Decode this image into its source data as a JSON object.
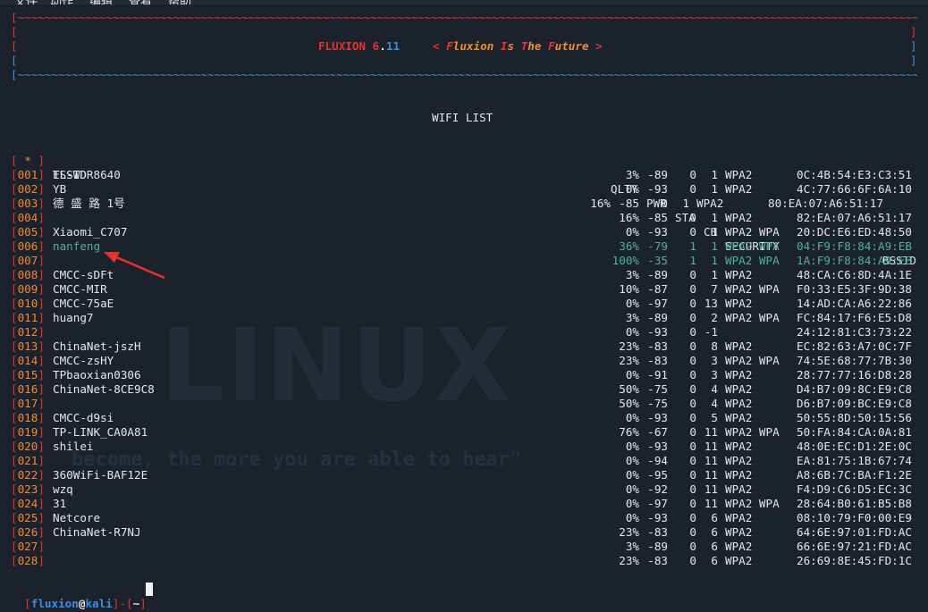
{
  "menu": [
    "文件",
    "动作",
    "编辑",
    "查看",
    "帮助"
  ],
  "banner": {
    "border_top": "[~~~~~~~~~~~~~~~~~~~~~~~~~~~~~~~~~~~~~~~~~~~~~~~~~~~~~~~~~~~~~~~~~~~~~~~~~~~~~~~~~~~~~~~~~~~~~~~~~~~~~~~~~~~~~~~~~~~~~~~~~~~~~~~~~~~~~~~~~~~~~~~~~~~~~~~~~~~~~~]",
    "name": "FLUXION",
    "version_major": "6",
    "version_dot": ".",
    "version_minor": "11",
    "tag_open": "<",
    "tag_words": [
      {
        "cap": "F",
        "rest": "luxion"
      },
      {
        "cap": "I",
        "rest": "s"
      },
      {
        "cap": "T",
        "rest": "he"
      },
      {
        "cap": "F",
        "rest": "uture"
      }
    ],
    "tag_close": ">",
    "border_bottom": "[~~~~~~~~~~~~~~~~~~~~~~~~~~~~~~~~~~~~~~~~~~~~~~~~~~~~~~~~~~~~~~~~~~~~~~~~~~~~~~~~~~~~~~~~~~~~~~~~~~~~~~~~~~~~~~~~~~~~~~~~~~~~~~~~~~~~~~~~~~~~~~~~~~~~~~~~~~~~~~]"
  },
  "title": "WIFI LIST",
  "header": {
    "marker": "[ * ]",
    "essid": "ESSID",
    "qlty": "QLTY",
    "pwr": "PWR",
    "sta": "STA",
    "ch": "CH",
    "security": "SECURITY",
    "bssid": "BSSID"
  },
  "rows": [
    {
      "id": "001",
      "essid": "TL-WDR8640",
      "qlty": "3%",
      "pwr": "-89",
      "sta": "0",
      "ch": "1",
      "sec": "WPA2",
      "bssid": "0C:4B:54:E3:C3:51",
      "hl": false
    },
    {
      "id": "002",
      "essid": "YB",
      "qlty": "0%",
      "pwr": "-93",
      "sta": "0",
      "ch": "1",
      "sec": "WPA2",
      "bssid": "4C:77:66:6F:6A:10",
      "hl": false
    },
    {
      "id": "003",
      "essid": "德 盛 路 1号",
      "qlty": "16%",
      "pwr": "-85",
      "sta": "0",
      "ch": "1",
      "sec": "WPA2",
      "bssid": "80:EA:07:A6:51:17",
      "hl": false,
      "shift": true
    },
    {
      "id": "004",
      "essid": "",
      "qlty": "16%",
      "pwr": "-85",
      "sta": "0",
      "ch": "1",
      "sec": "WPA2",
      "bssid": "82:EA:07:A6:51:17",
      "hl": false
    },
    {
      "id": "005",
      "essid": "Xiaomi_C707",
      "qlty": "0%",
      "pwr": "-93",
      "sta": "0",
      "ch": "1",
      "sec": "WPA2 WPA",
      "bssid": "20:DC:E6:ED:48:50",
      "hl": false
    },
    {
      "id": "006",
      "essid": "nanfeng",
      "qlty": "36%",
      "pwr": "-79",
      "sta": "1",
      "ch": "1",
      "sec": "WPA2 WPA",
      "bssid": "04:F9:F8:84:A9:EB",
      "hl": true
    },
    {
      "id": "007",
      "essid": "",
      "qlty": "100%",
      "pwr": "-35",
      "sta": "1",
      "ch": "1",
      "sec": "WPA2 WPA",
      "bssid": "1A:F9:F8:84:A9:EB",
      "hl": true
    },
    {
      "id": "008",
      "essid": "CMCC-sDFt",
      "qlty": "3%",
      "pwr": "-89",
      "sta": "0",
      "ch": "1",
      "sec": "WPA2",
      "bssid": "48:CA:C6:8D:4A:1E",
      "hl": false
    },
    {
      "id": "009",
      "essid": "CMCC-MIR",
      "qlty": "10%",
      "pwr": "-87",
      "sta": "0",
      "ch": "7",
      "sec": "WPA2 WPA",
      "bssid": "F0:33:E5:3F:9D:38",
      "hl": false
    },
    {
      "id": "010",
      "essid": "CMCC-75aE",
      "qlty": "0%",
      "pwr": "-97",
      "sta": "0",
      "ch": "13",
      "sec": "WPA2",
      "bssid": "14:AD:CA:A6:22:86",
      "hl": false
    },
    {
      "id": "011",
      "essid": "huang7",
      "qlty": "3%",
      "pwr": "-89",
      "sta": "0",
      "ch": "2",
      "sec": "WPA2 WPA",
      "bssid": "FC:84:17:F6:E5:D8",
      "hl": false
    },
    {
      "id": "012",
      "essid": "",
      "qlty": "0%",
      "pwr": "-93",
      "sta": "0",
      "ch": "-1",
      "sec": "",
      "bssid": "24:12:81:C3:73:22",
      "hl": false
    },
    {
      "id": "013",
      "essid": "ChinaNet-jszH",
      "qlty": "23%",
      "pwr": "-83",
      "sta": "0",
      "ch": "8",
      "sec": "WPA2",
      "bssid": "EC:82:63:A7:0C:7F",
      "hl": false
    },
    {
      "id": "014",
      "essid": "CMCC-zsHY",
      "qlty": "23%",
      "pwr": "-83",
      "sta": "0",
      "ch": "3",
      "sec": "WPA2 WPA",
      "bssid": "74:5E:68:77:7B:30",
      "hl": false
    },
    {
      "id": "015",
      "essid": "TPbaoxian0306",
      "qlty": "0%",
      "pwr": "-91",
      "sta": "0",
      "ch": "3",
      "sec": "WPA2",
      "bssid": "28:77:77:16:D8:28",
      "hl": false
    },
    {
      "id": "016",
      "essid": "ChinaNet-8CE9C8",
      "qlty": "50%",
      "pwr": "-75",
      "sta": "0",
      "ch": "4",
      "sec": "WPA2",
      "bssid": "D4:B7:09:8C:E9:C8",
      "hl": false
    },
    {
      "id": "017",
      "essid": "",
      "qlty": "50%",
      "pwr": "-75",
      "sta": "0",
      "ch": "4",
      "sec": "WPA2",
      "bssid": "D6:B7:09:BC:E9:C8",
      "hl": false
    },
    {
      "id": "018",
      "essid": "CMCC-d9si",
      "qlty": "0%",
      "pwr": "-93",
      "sta": "0",
      "ch": "5",
      "sec": "WPA2",
      "bssid": "50:55:8D:50:15:56",
      "hl": false
    },
    {
      "id": "019",
      "essid": "TP-LINK_CA0A81",
      "qlty": "76%",
      "pwr": "-67",
      "sta": "0",
      "ch": "11",
      "sec": "WPA2 WPA",
      "bssid": "50:FA:84:CA:0A:81",
      "hl": false
    },
    {
      "id": "020",
      "essid": "shilei",
      "qlty": "0%",
      "pwr": "-93",
      "sta": "0",
      "ch": "11",
      "sec": "WPA2",
      "bssid": "48:0E:EC:D1:2E:0C",
      "hl": false
    },
    {
      "id": "021",
      "essid": "",
      "qlty": "0%",
      "pwr": "-94",
      "sta": "0",
      "ch": "11",
      "sec": "WPA2",
      "bssid": "EA:81:75:1B:67:74",
      "hl": false
    },
    {
      "id": "022",
      "essid": "360WiFi-BAF12E",
      "qlty": "0%",
      "pwr": "-95",
      "sta": "0",
      "ch": "11",
      "sec": "WPA2",
      "bssid": "A8:6B:7C:BA:F1:2E",
      "hl": false
    },
    {
      "id": "023",
      "essid": "wzq",
      "qlty": "0%",
      "pwr": "-92",
      "sta": "0",
      "ch": "11",
      "sec": "WPA2",
      "bssid": "F4:D9:C6:D5:EC:3C",
      "hl": false
    },
    {
      "id": "024",
      "essid": "31",
      "qlty": "0%",
      "pwr": "-97",
      "sta": "0",
      "ch": "11",
      "sec": "WPA2 WPA",
      "bssid": "28:64:B0:61:B5:B8",
      "hl": false
    },
    {
      "id": "025",
      "essid": "Netcore",
      "qlty": "0%",
      "pwr": "-93",
      "sta": "0",
      "ch": "6",
      "sec": "WPA2",
      "bssid": "08:10:79:F0:00:E9",
      "hl": false
    },
    {
      "id": "026",
      "essid": "ChinaNet-R7NJ",
      "qlty": "23%",
      "pwr": "-83",
      "sta": "0",
      "ch": "6",
      "sec": "WPA2",
      "bssid": "64:6E:97:01:FD:AC",
      "hl": false
    },
    {
      "id": "027",
      "essid": "",
      "qlty": "3%",
      "pwr": "-89",
      "sta": "0",
      "ch": "6",
      "sec": "WPA2",
      "bssid": "66:6E:97:21:FD:AC",
      "hl": false
    },
    {
      "id": "028",
      "essid": "",
      "qlty": "23%",
      "pwr": "-83",
      "sta": "0",
      "ch": "6",
      "sec": "WPA2",
      "bssid": "26:69:8E:45:FD:1C",
      "hl": false
    }
  ],
  "prompt": {
    "open": "[",
    "user": "fluxion",
    "at": "@",
    "host": "kali",
    "close": "]",
    "dash": "-",
    "path_open": "[",
    "path": "~",
    "path_close": "]"
  },
  "watermark": {
    "text": "LINUX",
    "quote": "become, the more you are able to hear\""
  },
  "colors": {
    "background": "#1c222c",
    "red": "#e8322d",
    "blue": "#3a8ee6",
    "orange": "#f28b2c",
    "teal": "#4db39a",
    "arrow": "#e8322d"
  }
}
